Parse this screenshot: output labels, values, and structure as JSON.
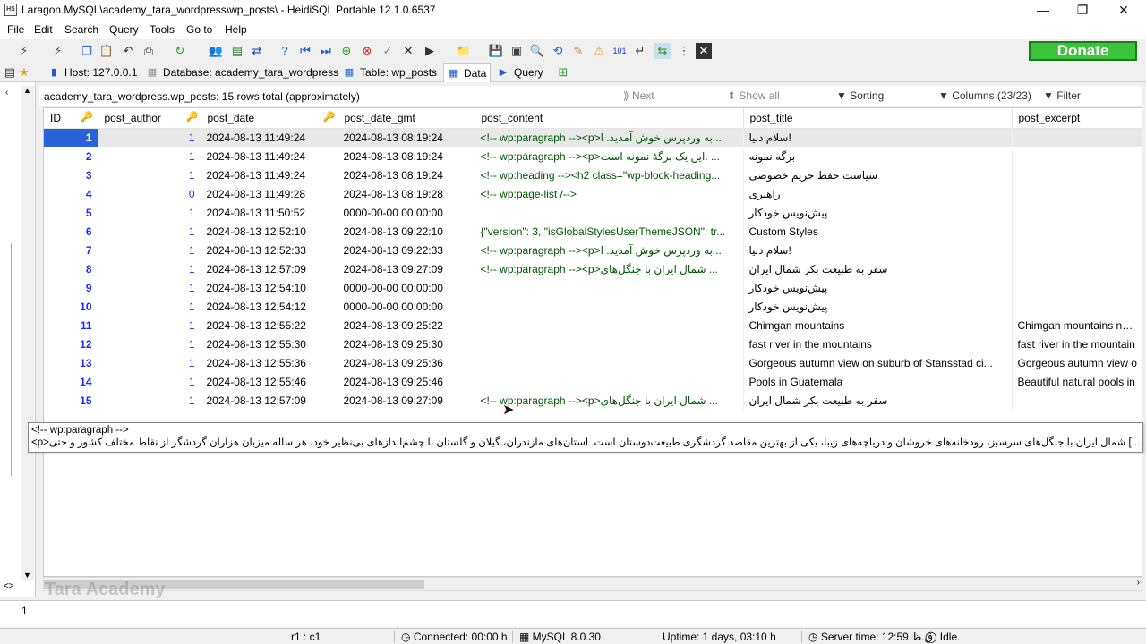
{
  "window": {
    "title": "Laragon.MySQL\\academy_tara_wordpress\\wp_posts\\ - HeidiSQL Portable 12.1.0.6537",
    "minimize": "—",
    "maximize": "❐",
    "close": "✕"
  },
  "menu": [
    "File",
    "Edit",
    "Search",
    "Query",
    "Tools",
    "Go to",
    "Help"
  ],
  "toolbar": {
    "donate_label": "Donate"
  },
  "tabs": [
    {
      "label": "Host: 127.0.0.1",
      "icon": "host-icon"
    },
    {
      "label": "Database: academy_tara_wordpress",
      "icon": "database-icon"
    },
    {
      "label": "Table: wp_posts",
      "icon": "table-icon"
    },
    {
      "label": "Data",
      "icon": "grid-icon"
    },
    {
      "label": "Query",
      "icon": "play-icon"
    }
  ],
  "gridbar": {
    "info": "academy_tara_wordpress.wp_posts: 15 rows total (approximately)",
    "next": "Next",
    "show_all": "Show all",
    "sorting": "Sorting",
    "columns": "Columns (23/23)",
    "filter": "Filter"
  },
  "columns": [
    "ID",
    "post_author",
    "post_date",
    "post_date_gmt",
    "post_content",
    "post_title",
    "post_excerpt"
  ],
  "rows": [
    [
      "1",
      "1",
      "2024-08-13 11:49:24",
      "2024-08-13 08:19:24",
      "<!-- wp:paragraph --><p>به وردپرس خوش آمدید. ا...",
      "!سلام دنیا",
      ""
    ],
    [
      "2",
      "1",
      "2024-08-13 11:49:24",
      "2024-08-13 08:19:24",
      "<!-- wp:paragraph --><p>این یک برگهٔ نمونه است. ...",
      "برگه نمونه",
      ""
    ],
    [
      "3",
      "1",
      "2024-08-13 11:49:24",
      "2024-08-13 08:19:24",
      "<!-- wp:heading --><h2 class=\"wp-block-heading...",
      "سیاست حفظ حریم خصوصی",
      ""
    ],
    [
      "4",
      "0",
      "2024-08-13 11:49:28",
      "2024-08-13 08:19:28",
      "<!-- wp:page-list /-->",
      "راهبری",
      ""
    ],
    [
      "5",
      "1",
      "2024-08-13 11:50:52",
      "0000-00-00 00:00:00",
      "",
      "پیش‌نویس خودکار",
      ""
    ],
    [
      "6",
      "1",
      "2024-08-13 12:52:10",
      "2024-08-13 09:22:10",
      "{\"version\": 3, \"isGlobalStylesUserThemeJSON\": tr...",
      "Custom Styles",
      ""
    ],
    [
      "7",
      "1",
      "2024-08-13 12:52:33",
      "2024-08-13 09:22:33",
      "<!-- wp:paragraph --><p>به وردپرس خوش آمدید. ا...",
      "!سلام دنیا",
      ""
    ],
    [
      "8",
      "1",
      "2024-08-13 12:57:09",
      "2024-08-13 09:27:09",
      "<!-- wp:paragraph --><p>شمال ایران با جنگل‌های ...",
      "سفر به طبیعت بکر شمال ایران",
      ""
    ],
    [
      "9",
      "1",
      "2024-08-13 12:54:10",
      "0000-00-00 00:00:00",
      "",
      "پیش‌نویس خودکار",
      ""
    ],
    [
      "10",
      "1",
      "2024-08-13 12:54:12",
      "0000-00-00 00:00:00",
      "",
      "پیش‌نویس خودکار",
      ""
    ],
    [
      "11",
      "1",
      "2024-08-13 12:55:22",
      "2024-08-13 09:25:22",
      "",
      "Chimgan mountains",
      "Chimgan mountains near"
    ],
    [
      "12",
      "1",
      "2024-08-13 12:55:30",
      "2024-08-13 09:25:30",
      "",
      "fast river in the mountains",
      "fast river in the mountain"
    ],
    [
      "13",
      "1",
      "2024-08-13 12:55:36",
      "2024-08-13 09:25:36",
      "",
      "Gorgeous autumn view on suburb of Stansstad ci...",
      "Gorgeous autumn view o"
    ],
    [
      "14",
      "1",
      "2024-08-13 12:55:46",
      "2024-08-13 09:25:46",
      "",
      "Pools in Guatemala",
      "Beautiful natural pools in"
    ],
    [
      "15",
      "1",
      "2024-08-13 12:57:09",
      "2024-08-13 09:27:09",
      "<!-- wp:paragraph --><p>شمال ایران با جنگل‌های ...",
      "سفر به طبیعت بکر شمال ایران",
      ""
    ]
  ],
  "tooltip": {
    "line1": "<!-- wp:paragraph -->",
    "line2": "<p>شمال ایران با جنگل‌های سرسبز، رودخانه‌های خروشان و دریاچه‌های زیبا، یکی از بهترین مقاصد گردشگری طبیعت‌دوستان است. استان‌های مازندران، گیلان و گلستان با چشم‌اندازهای بی‌نظیر خود، هر ساله میزبان هزاران گردشگر از نقاط مختلف کشور و حتی [...]"
  },
  "watermark": "Tara Academy",
  "log": {
    "line_number": "1"
  },
  "status": {
    "cursor": "r1 : c1",
    "connected": "Connected: 00:00 h",
    "server": "MySQL 8.0.30",
    "uptime": "Uptime: 1 days, 03:10 h",
    "server_time": "Server time: 12:59 ق.ظ",
    "state": "Idle."
  },
  "colors": {
    "selection": "#2962d9",
    "id_text": "#1b2bff",
    "donate": "#3bc43b"
  }
}
